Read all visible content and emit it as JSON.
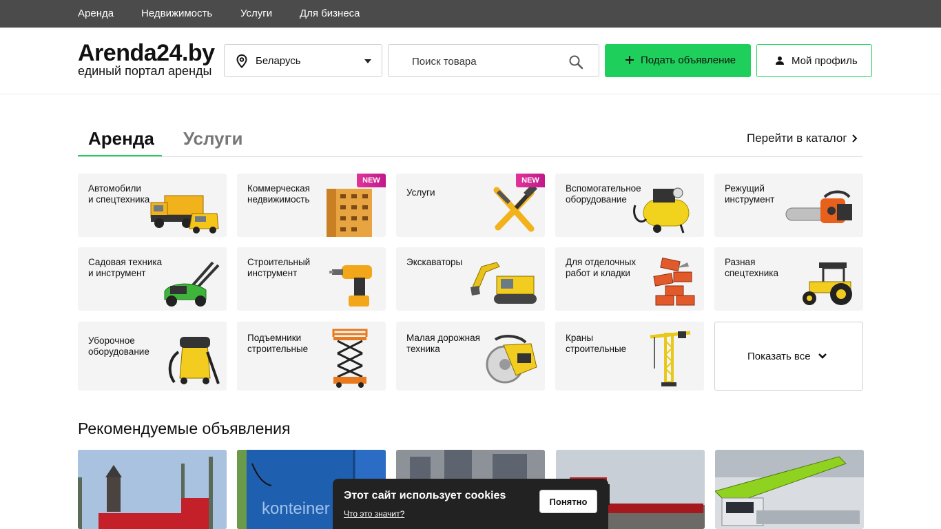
{
  "topnav": [
    "Аренда",
    "Недвижимость",
    "Услуги",
    "Для бизнеса"
  ],
  "logo": {
    "title": "Arenda24.by",
    "subtitle": "единый портал аренды"
  },
  "region": {
    "label": "Беларусь"
  },
  "search": {
    "placeholder": "Поиск товара"
  },
  "buttons": {
    "post_ad": "Подать объявление",
    "profile": "Мой профиль"
  },
  "tabs": [
    {
      "label": "Аренда",
      "active": true
    },
    {
      "label": "Услуги",
      "active": false
    }
  ],
  "catalog_link": "Перейти в каталог",
  "categories": [
    {
      "label": "Автомобили\nи спецтехника",
      "icon": "truck",
      "new": false
    },
    {
      "label": "Коммерческая\nнедвижимость",
      "icon": "building",
      "new": true
    },
    {
      "label": "Услуги",
      "icon": "tools",
      "new": true
    },
    {
      "label": "Вспомогательное\nоборудование",
      "icon": "compressor",
      "new": false
    },
    {
      "label": "Режущий\nинструмент",
      "icon": "chainsaw",
      "new": false
    },
    {
      "label": "Садовая техника\nи инструмент",
      "icon": "lawnmower",
      "new": false
    },
    {
      "label": "Строительный\nинструмент",
      "icon": "drill",
      "new": false
    },
    {
      "label": "Экскаваторы",
      "icon": "excavator",
      "new": false
    },
    {
      "label": "Для отделочных\nработ и кладки",
      "icon": "bricks",
      "new": false
    },
    {
      "label": "Разная\nспецтехника",
      "icon": "tractor",
      "new": false
    },
    {
      "label": "Уборочное\nоборудование",
      "icon": "vacuum",
      "new": false
    },
    {
      "label": "Подъемники\nстроительные",
      "icon": "scissor-lift",
      "new": false
    },
    {
      "label": "Малая дорожная\nтехника",
      "icon": "road-saw",
      "new": false
    },
    {
      "label": "Краны\nстроительные",
      "icon": "crane",
      "new": false
    }
  ],
  "badge_new": "NEW",
  "show_all": "Показать все",
  "recommended": {
    "title": "Рекомендуемые объявления",
    "cards": [
      {
        "image": "truck-photo"
      },
      {
        "image": "container-photo",
        "overlay_text": "konteiner"
      },
      {
        "image": "building-photo"
      },
      {
        "image": "flatbed-truck-photo"
      },
      {
        "image": "crane-truck-photo"
      }
    ]
  },
  "cookie": {
    "title": "Этот сайт использует cookies",
    "link": "Что это значит?",
    "button": "Понятно"
  },
  "colors": {
    "accent": "#1ed05b",
    "topbar": "#4b4b4b",
    "badge": "#d0268f"
  }
}
